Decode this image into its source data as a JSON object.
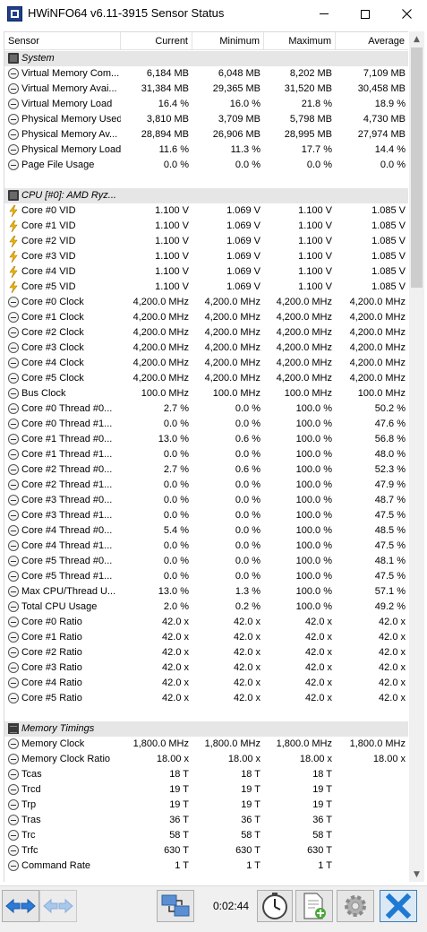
{
  "window": {
    "title": "HWiNFO64 v6.11-3915 Sensor Status",
    "minimize_icon": "minimize-icon",
    "maximize_icon": "maximize-icon",
    "close_icon": "close-icon"
  },
  "columns": [
    "Sensor",
    "Current",
    "Minimum",
    "Maximum",
    "Average"
  ],
  "rows": [
    {
      "type": "group",
      "icon": "chip-icon",
      "sensor": "System",
      "current": "",
      "minimum": "",
      "maximum": "",
      "average": ""
    },
    {
      "type": "item",
      "icon": "clock-icon",
      "sensor": "Virtual Memory Com...",
      "current": "6,184 MB",
      "minimum": "6,048 MB",
      "maximum": "8,202 MB",
      "average": "7,109 MB"
    },
    {
      "type": "item",
      "icon": "clock-icon",
      "sensor": "Virtual Memory Avai...",
      "current": "31,384 MB",
      "minimum": "29,365 MB",
      "maximum": "31,520 MB",
      "average": "30,458 MB"
    },
    {
      "type": "item",
      "icon": "clock-icon",
      "sensor": "Virtual Memory Load",
      "current": "16.4 %",
      "minimum": "16.0 %",
      "maximum": "21.8 %",
      "average": "18.9 %"
    },
    {
      "type": "item",
      "icon": "clock-icon",
      "sensor": "Physical Memory Used",
      "current": "3,810 MB",
      "minimum": "3,709 MB",
      "maximum": "5,798 MB",
      "average": "4,730 MB"
    },
    {
      "type": "item",
      "icon": "clock-icon",
      "sensor": "Physical Memory Av...",
      "current": "28,894 MB",
      "minimum": "26,906 MB",
      "maximum": "28,995 MB",
      "average": "27,974 MB"
    },
    {
      "type": "item",
      "icon": "clock-icon",
      "sensor": "Physical Memory Load",
      "current": "11.6 %",
      "minimum": "11.3 %",
      "maximum": "17.7 %",
      "average": "14.4 %"
    },
    {
      "type": "item",
      "icon": "clock-icon",
      "sensor": "Page File Usage",
      "current": "0.0 %",
      "minimum": "0.0 %",
      "maximum": "0.0 %",
      "average": "0.0 %"
    },
    {
      "type": "blank",
      "icon": "",
      "sensor": "",
      "current": "",
      "minimum": "",
      "maximum": "",
      "average": ""
    },
    {
      "type": "group",
      "icon": "chip-icon",
      "sensor": "CPU [#0]: AMD Ryz...",
      "current": "",
      "minimum": "",
      "maximum": "",
      "average": ""
    },
    {
      "type": "item",
      "icon": "voltage-icon",
      "sensor": "Core #0 VID",
      "current": "1.100 V",
      "minimum": "1.069 V",
      "maximum": "1.100 V",
      "average": "1.085 V"
    },
    {
      "type": "item",
      "icon": "voltage-icon",
      "sensor": "Core #1 VID",
      "current": "1.100 V",
      "minimum": "1.069 V",
      "maximum": "1.100 V",
      "average": "1.085 V"
    },
    {
      "type": "item",
      "icon": "voltage-icon",
      "sensor": "Core #2 VID",
      "current": "1.100 V",
      "minimum": "1.069 V",
      "maximum": "1.100 V",
      "average": "1.085 V"
    },
    {
      "type": "item",
      "icon": "voltage-icon",
      "sensor": "Core #3 VID",
      "current": "1.100 V",
      "minimum": "1.069 V",
      "maximum": "1.100 V",
      "average": "1.085 V"
    },
    {
      "type": "item",
      "icon": "voltage-icon",
      "sensor": "Core #4 VID",
      "current": "1.100 V",
      "minimum": "1.069 V",
      "maximum": "1.100 V",
      "average": "1.085 V"
    },
    {
      "type": "item",
      "icon": "voltage-icon",
      "sensor": "Core #5 VID",
      "current": "1.100 V",
      "minimum": "1.069 V",
      "maximum": "1.100 V",
      "average": "1.085 V"
    },
    {
      "type": "item",
      "icon": "clock-icon",
      "sensor": "Core #0 Clock",
      "current": "4,200.0 MHz",
      "minimum": "4,200.0 MHz",
      "maximum": "4,200.0 MHz",
      "average": "4,200.0 MHz"
    },
    {
      "type": "item",
      "icon": "clock-icon",
      "sensor": "Core #1 Clock",
      "current": "4,200.0 MHz",
      "minimum": "4,200.0 MHz",
      "maximum": "4,200.0 MHz",
      "average": "4,200.0 MHz"
    },
    {
      "type": "item",
      "icon": "clock-icon",
      "sensor": "Core #2 Clock",
      "current": "4,200.0 MHz",
      "minimum": "4,200.0 MHz",
      "maximum": "4,200.0 MHz",
      "average": "4,200.0 MHz"
    },
    {
      "type": "item",
      "icon": "clock-icon",
      "sensor": "Core #3 Clock",
      "current": "4,200.0 MHz",
      "minimum": "4,200.0 MHz",
      "maximum": "4,200.0 MHz",
      "average": "4,200.0 MHz"
    },
    {
      "type": "item",
      "icon": "clock-icon",
      "sensor": "Core #4 Clock",
      "current": "4,200.0 MHz",
      "minimum": "4,200.0 MHz",
      "maximum": "4,200.0 MHz",
      "average": "4,200.0 MHz"
    },
    {
      "type": "item",
      "icon": "clock-icon",
      "sensor": "Core #5 Clock",
      "current": "4,200.0 MHz",
      "minimum": "4,200.0 MHz",
      "maximum": "4,200.0 MHz",
      "average": "4,200.0 MHz"
    },
    {
      "type": "item",
      "icon": "clock-icon",
      "sensor": "Bus Clock",
      "current": "100.0 MHz",
      "minimum": "100.0 MHz",
      "maximum": "100.0 MHz",
      "average": "100.0 MHz"
    },
    {
      "type": "item",
      "icon": "clock-icon",
      "sensor": "Core #0 Thread #0...",
      "current": "2.7 %",
      "minimum": "0.0 %",
      "maximum": "100.0 %",
      "average": "50.2 %"
    },
    {
      "type": "item",
      "icon": "clock-icon",
      "sensor": "Core #0 Thread #1...",
      "current": "0.0 %",
      "minimum": "0.0 %",
      "maximum": "100.0 %",
      "average": "47.6 %"
    },
    {
      "type": "item",
      "icon": "clock-icon",
      "sensor": "Core #1 Thread #0...",
      "current": "13.0 %",
      "minimum": "0.6 %",
      "maximum": "100.0 %",
      "average": "56.8 %"
    },
    {
      "type": "item",
      "icon": "clock-icon",
      "sensor": "Core #1 Thread #1...",
      "current": "0.0 %",
      "minimum": "0.0 %",
      "maximum": "100.0 %",
      "average": "48.0 %"
    },
    {
      "type": "item",
      "icon": "clock-icon",
      "sensor": "Core #2 Thread #0...",
      "current": "2.7 %",
      "minimum": "0.6 %",
      "maximum": "100.0 %",
      "average": "52.3 %"
    },
    {
      "type": "item",
      "icon": "clock-icon",
      "sensor": "Core #2 Thread #1...",
      "current": "0.0 %",
      "minimum": "0.0 %",
      "maximum": "100.0 %",
      "average": "47.9 %"
    },
    {
      "type": "item",
      "icon": "clock-icon",
      "sensor": "Core #3 Thread #0...",
      "current": "0.0 %",
      "minimum": "0.0 %",
      "maximum": "100.0 %",
      "average": "48.7 %"
    },
    {
      "type": "item",
      "icon": "clock-icon",
      "sensor": "Core #3 Thread #1...",
      "current": "0.0 %",
      "minimum": "0.0 %",
      "maximum": "100.0 %",
      "average": "47.5 %"
    },
    {
      "type": "item",
      "icon": "clock-icon",
      "sensor": "Core #4 Thread #0...",
      "current": "5.4 %",
      "minimum": "0.0 %",
      "maximum": "100.0 %",
      "average": "48.5 %"
    },
    {
      "type": "item",
      "icon": "clock-icon",
      "sensor": "Core #4 Thread #1...",
      "current": "0.0 %",
      "minimum": "0.0 %",
      "maximum": "100.0 %",
      "average": "47.5 %"
    },
    {
      "type": "item",
      "icon": "clock-icon",
      "sensor": "Core #5 Thread #0...",
      "current": "0.0 %",
      "minimum": "0.0 %",
      "maximum": "100.0 %",
      "average": "48.1 %"
    },
    {
      "type": "item",
      "icon": "clock-icon",
      "sensor": "Core #5 Thread #1...",
      "current": "0.0 %",
      "minimum": "0.0 %",
      "maximum": "100.0 %",
      "average": "47.5 %"
    },
    {
      "type": "item",
      "icon": "clock-icon",
      "sensor": "Max CPU/Thread U...",
      "current": "13.0 %",
      "minimum": "1.3 %",
      "maximum": "100.0 %",
      "average": "57.1 %"
    },
    {
      "type": "item",
      "icon": "clock-icon",
      "sensor": "Total CPU Usage",
      "current": "2.0 %",
      "minimum": "0.2 %",
      "maximum": "100.0 %",
      "average": "49.2 %"
    },
    {
      "type": "item",
      "icon": "clock-icon",
      "sensor": "Core #0 Ratio",
      "current": "42.0 x",
      "minimum": "42.0 x",
      "maximum": "42.0 x",
      "average": "42.0 x"
    },
    {
      "type": "item",
      "icon": "clock-icon",
      "sensor": "Core #1 Ratio",
      "current": "42.0 x",
      "minimum": "42.0 x",
      "maximum": "42.0 x",
      "average": "42.0 x"
    },
    {
      "type": "item",
      "icon": "clock-icon",
      "sensor": "Core #2 Ratio",
      "current": "42.0 x",
      "minimum": "42.0 x",
      "maximum": "42.0 x",
      "average": "42.0 x"
    },
    {
      "type": "item",
      "icon": "clock-icon",
      "sensor": "Core #3 Ratio",
      "current": "42.0 x",
      "minimum": "42.0 x",
      "maximum": "42.0 x",
      "average": "42.0 x"
    },
    {
      "type": "item",
      "icon": "clock-icon",
      "sensor": "Core #4 Ratio",
      "current": "42.0 x",
      "minimum": "42.0 x",
      "maximum": "42.0 x",
      "average": "42.0 x"
    },
    {
      "type": "item",
      "icon": "clock-icon",
      "sensor": "Core #5 Ratio",
      "current": "42.0 x",
      "minimum": "42.0 x",
      "maximum": "42.0 x",
      "average": "42.0 x"
    },
    {
      "type": "blank",
      "icon": "",
      "sensor": "",
      "current": "",
      "minimum": "",
      "maximum": "",
      "average": ""
    },
    {
      "type": "group",
      "icon": "memory-icon",
      "sensor": "Memory Timings",
      "current": "",
      "minimum": "",
      "maximum": "",
      "average": ""
    },
    {
      "type": "item",
      "icon": "clock-icon",
      "sensor": "Memory Clock",
      "current": "1,800.0 MHz",
      "minimum": "1,800.0 MHz",
      "maximum": "1,800.0 MHz",
      "average": "1,800.0 MHz"
    },
    {
      "type": "item",
      "icon": "clock-icon",
      "sensor": "Memory Clock Ratio",
      "current": "18.00 x",
      "minimum": "18.00 x",
      "maximum": "18.00 x",
      "average": "18.00 x"
    },
    {
      "type": "item",
      "icon": "clock-icon",
      "sensor": "Tcas",
      "current": "18 T",
      "minimum": "18 T",
      "maximum": "18 T",
      "average": ""
    },
    {
      "type": "item",
      "icon": "clock-icon",
      "sensor": "Trcd",
      "current": "19 T",
      "minimum": "19 T",
      "maximum": "19 T",
      "average": ""
    },
    {
      "type": "item",
      "icon": "clock-icon",
      "sensor": "Trp",
      "current": "19 T",
      "minimum": "19 T",
      "maximum": "19 T",
      "average": ""
    },
    {
      "type": "item",
      "icon": "clock-icon",
      "sensor": "Tras",
      "current": "36 T",
      "minimum": "36 T",
      "maximum": "36 T",
      "average": ""
    },
    {
      "type": "item",
      "icon": "clock-icon",
      "sensor": "Trc",
      "current": "58 T",
      "minimum": "58 T",
      "maximum": "58 T",
      "average": ""
    },
    {
      "type": "item",
      "icon": "clock-icon",
      "sensor": "Trfc",
      "current": "630 T",
      "minimum": "630 T",
      "maximum": "630 T",
      "average": ""
    },
    {
      "type": "item",
      "icon": "clock-icon",
      "sensor": "Command Rate",
      "current": "1 T",
      "minimum": "1 T",
      "maximum": "1 T",
      "average": ""
    }
  ],
  "toolbar": {
    "timer": "0:02:44",
    "nav_icon": "arrows-left-right-icon",
    "nav_disabled_icon": "arrows-left-right-disabled-icon",
    "network_icon": "network-computers-icon",
    "clock_icon": "stopwatch-icon",
    "report_icon": "report-add-icon",
    "settings_icon": "gear-icon",
    "close_icon": "close-x-icon"
  },
  "colors": {
    "group_row": "#e6e6e6",
    "close_button": "#1e79d3",
    "nav_arrow": "#2b7bd8",
    "voltage_icon": "#f2b600"
  }
}
